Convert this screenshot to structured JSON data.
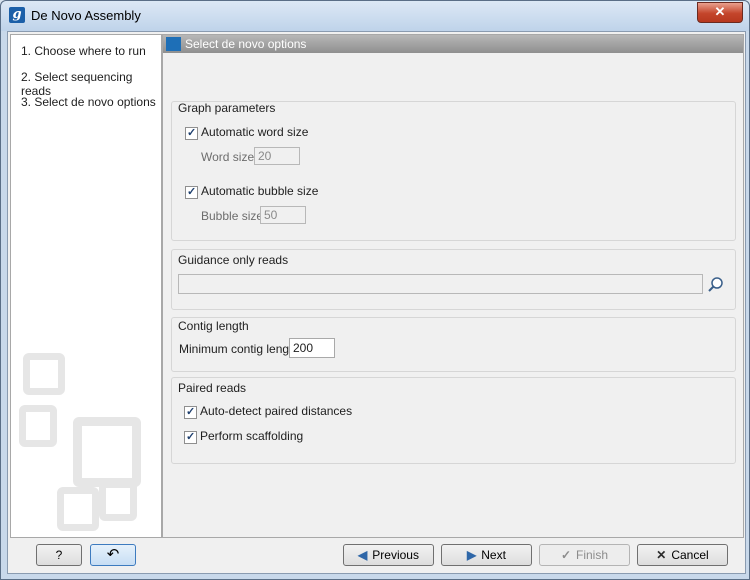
{
  "window": {
    "title": "De Novo Assembly",
    "app_icon_letter": "g",
    "close_glyph": "✕"
  },
  "steps": [
    {
      "label": "1.  Choose where to run"
    },
    {
      "label": "2.  Select sequencing reads"
    },
    {
      "label": "3.  Select de novo options"
    }
  ],
  "panel": {
    "header": "Select de novo options",
    "graph": {
      "title": "Graph parameters",
      "auto_word_label": "Automatic word size",
      "auto_word_checked": true,
      "word_size_label": "Word size",
      "word_size_value": "20",
      "auto_bubble_label": "Automatic bubble size",
      "auto_bubble_checked": true,
      "bubble_size_label": "Bubble size",
      "bubble_size_value": "50"
    },
    "guidance": {
      "title": "Guidance only reads",
      "value": ""
    },
    "contig": {
      "title": "Contig length",
      "min_label": "Minimum contig length",
      "min_value": "200"
    },
    "paired": {
      "title": "Paired reads",
      "auto_detect_label": "Auto-detect paired distances",
      "auto_detect_checked": true,
      "scaffold_label": "Perform scaffolding",
      "scaffold_checked": true
    }
  },
  "buttons": {
    "help": "?",
    "reset_glyph": "↶",
    "previous": "Previous",
    "next": "Next",
    "finish": "Finish",
    "cancel": "Cancel"
  },
  "colors": {
    "accent": "#1e6fb7",
    "header_bar": "#9c9c9c",
    "title_bar": "#c9dbef"
  }
}
